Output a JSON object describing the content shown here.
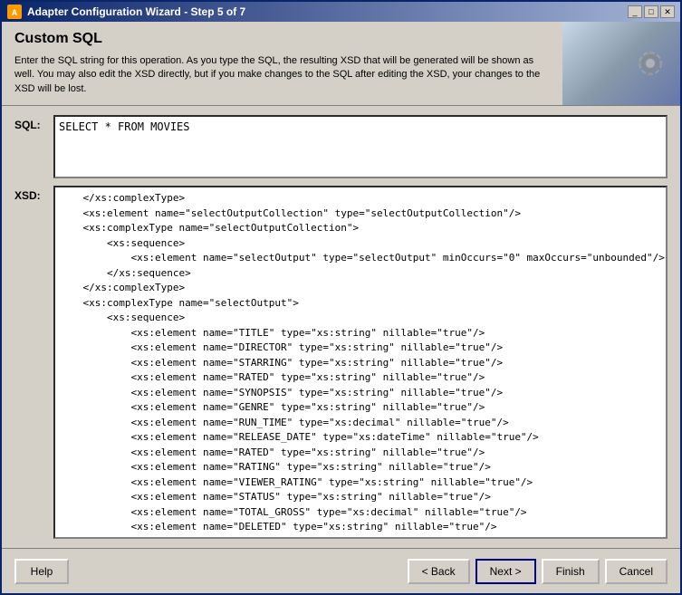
{
  "window": {
    "title": "Adapter Configuration Wizard - Step 5 of 7",
    "icon": "⚙"
  },
  "titlebar": {
    "minimize_label": "_",
    "maximize_label": "□",
    "close_label": "✕"
  },
  "header": {
    "title": "Custom SQL",
    "description": "Enter the SQL string for this operation.  As you type the SQL, the resulting XSD that will be generated will be shown as well.  You may also edit the XSD directly, but if you make changes to the SQL after editing the XSD, your changes to the XSD will be lost."
  },
  "sql_section": {
    "label": "SQL:",
    "value": "SELECT * FROM MOVIES"
  },
  "xsd_section": {
    "label": "XSD:",
    "content": "    </xs:complexType>\n    <xs:element name=\"selectOutputCollection\" type=\"selectOutputCollection\"/>\n    <xs:complexType name=\"selectOutputCollection\">\n        <xs:sequence>\n            <xs:element name=\"selectOutput\" type=\"selectOutput\" minOccurs=\"0\" maxOccurs=\"unbounded\"/>\n        </xs:sequence>\n    </xs:complexType>\n    <xs:complexType name=\"selectOutput\">\n        <xs:sequence>\n            <xs:element name=\"TITLE\" type=\"xs:string\" nillable=\"true\"/>\n            <xs:element name=\"DIRECTOR\" type=\"xs:string\" nillable=\"true\"/>\n            <xs:element name=\"STARRING\" type=\"xs:string\" nillable=\"true\"/>\n            <xs:element name=\"RATED\" type=\"xs:string\" nillable=\"true\"/>\n            <xs:element name=\"SYNOPSIS\" type=\"xs:string\" nillable=\"true\"/>\n            <xs:element name=\"GENRE\" type=\"xs:string\" nillable=\"true\"/>\n            <xs:element name=\"RUN_TIME\" type=\"xs:decimal\" nillable=\"true\"/>\n            <xs:element name=\"RELEASE_DATE\" type=\"xs:dateTime\" nillable=\"true\"/>\n            <xs:element name=\"RATED\" type=\"xs:string\" nillable=\"true\"/>\n            <xs:element name=\"RATING\" type=\"xs:string\" nillable=\"true\"/>\n            <xs:element name=\"VIEWER_RATING\" type=\"xs:string\" nillable=\"true\"/>\n            <xs:element name=\"STATUS\" type=\"xs:string\" nillable=\"true\"/>\n            <xs:element name=\"TOTAL_GROSS\" type=\"xs:decimal\" nillable=\"true\"/>\n            <xs:element name=\"DELETED\" type=\"xs:string\" nillable=\"true\"/>\n            <xs:element name=\"SEQUENCENO\" type=\"xs:decimal\" nillable=\"true\"/>\n            <xs:element name=\"LAST_UPDATED\" type=\"xs:dateTime\" nillable=\"true\"/>"
  },
  "buttons": {
    "help": "Help",
    "back": "< Back",
    "next": "Next >",
    "finish": "Finish",
    "cancel": "Cancel"
  }
}
